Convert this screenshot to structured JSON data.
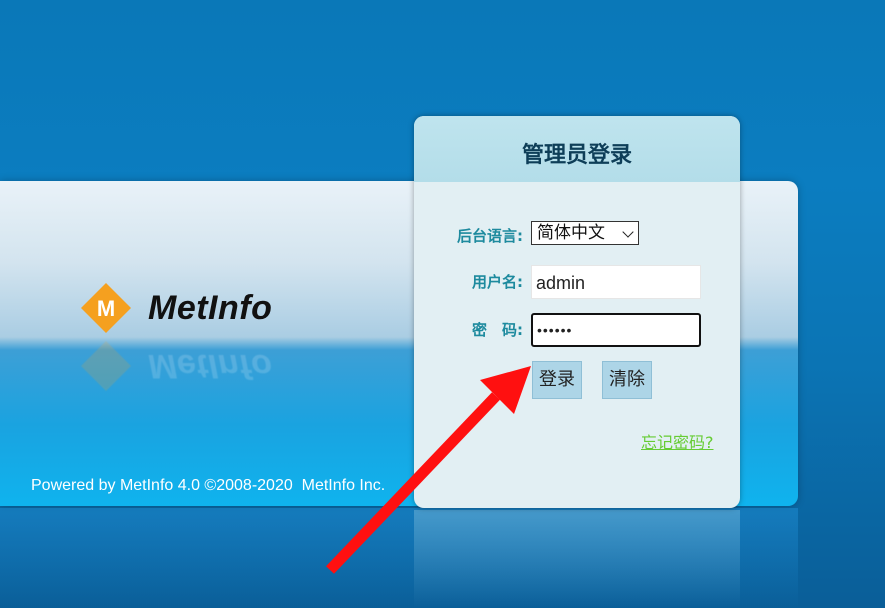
{
  "panel": {
    "title": "管理员登录",
    "language_label": "后台语言:",
    "language_value": "简体中文",
    "username_label": "用户名:",
    "username_value": "admin",
    "password_label": "密　码:",
    "password_value": "••••••",
    "login_button": "登录",
    "clear_button": "清除",
    "forgot_link": "忘记密码?"
  },
  "logo": {
    "letter": "M",
    "text": "MetInfo"
  },
  "footer": {
    "powered_text": "Powered by MetInfo 4.0 ©2008-2020  MetInfo Inc."
  },
  "colors": {
    "background": "#0b7dc0",
    "label": "#1d8a9e",
    "link": "#66cc33",
    "arrow": "#ff1010",
    "logo_orange": "#f5a01f"
  },
  "icons": {
    "logo_mark": "metinfo-diamond-logo",
    "pointer": "red-arrow-annotation",
    "select_caret": "chevron-down-icon"
  }
}
